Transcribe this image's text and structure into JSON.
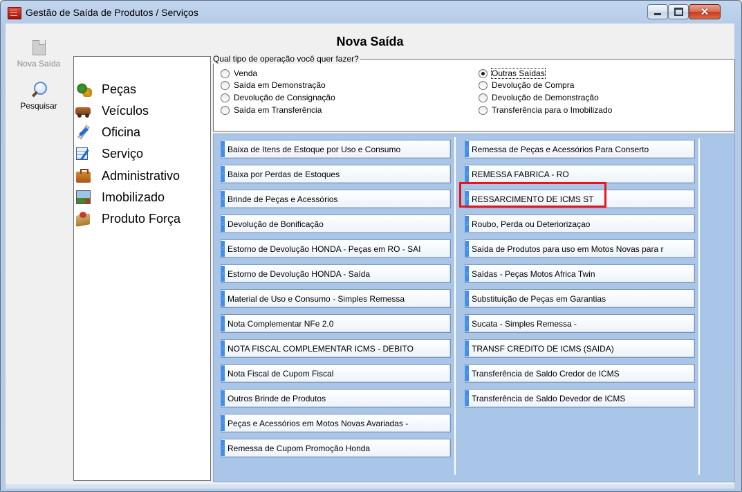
{
  "window": {
    "title": "Gestão de Saída de Produtos / Serviços"
  },
  "header": {
    "title": "Nova Saída"
  },
  "toolbar": {
    "new_label": "Nova Saída",
    "search_label": "Pesquisar"
  },
  "categories": [
    {
      "label": "Peças",
      "icon": "parts-icon"
    },
    {
      "label": "Veículos",
      "icon": "vehicle-icon"
    },
    {
      "label": "Oficina",
      "icon": "workshop-icon"
    },
    {
      "label": "Serviço",
      "icon": "service-icon"
    },
    {
      "label": "Administrativo",
      "icon": "admin-icon"
    },
    {
      "label": "Imobilizado",
      "icon": "fixed-asset-icon"
    },
    {
      "label": "Produto Força",
      "icon": "product-force-icon"
    }
  ],
  "operation": {
    "question": "Qual tipo de operação você quer fazer?",
    "options_left": [
      "Venda",
      "Saída em Demonstração",
      "Devolução de Consignação",
      "Saída em Transferência"
    ],
    "options_right": [
      "Outras Saídas",
      "Devolução de Compra",
      "Devolução de Demonstração",
      "Transferência para o Imobilizado"
    ],
    "selected": "Outras Saídas"
  },
  "list_left": [
    "Baixa de Itens de Estoque por Uso e Consumo",
    "Baixa por Perdas de Estoques",
    "Brinde de Peças e Acessórios",
    "Devolução de Bonificação",
    "Estorno de Devolução HONDA - Peças em RO - SAI",
    "Estorno de Devolução HONDA - Saída",
    "Material de Uso e Consumo - Simples Remessa",
    "Nota Complementar NFe 2.0",
    "NOTA FISCAL COMPLEMENTAR ICMS - DEBITO",
    "Nota Fiscal de Cupom Fiscal",
    "Outros Brinde de  Produtos",
    "Peças e Acessórios em Motos Novas Avariadas -",
    "Remessa de Cupom Promoção Honda"
  ],
  "list_right": [
    "Remessa de Peças e Acessórios Para Conserto",
    "REMESSA FABRICA - RO",
    "RESSARCIMENTO DE ICMS ST",
    "Roubo, Perda ou Deteriorizaçao",
    "Saída de Produtos para uso em Motos Novas para r",
    "Saídas -  Peças Motos Africa Twin",
    "Substituição de Peças em Garantias",
    "Sucata - Simples Remessa -",
    "TRANSF CREDITO DE ICMS (SAIDA)",
    "Transferência de Saldo Credor de ICMS",
    "Transferência de Saldo Devedor de ICMS"
  ],
  "colors": {
    "list_bg": "#a9c6e8",
    "accent_bar": "#3d8ef0",
    "highlight": "#e8151c"
  }
}
